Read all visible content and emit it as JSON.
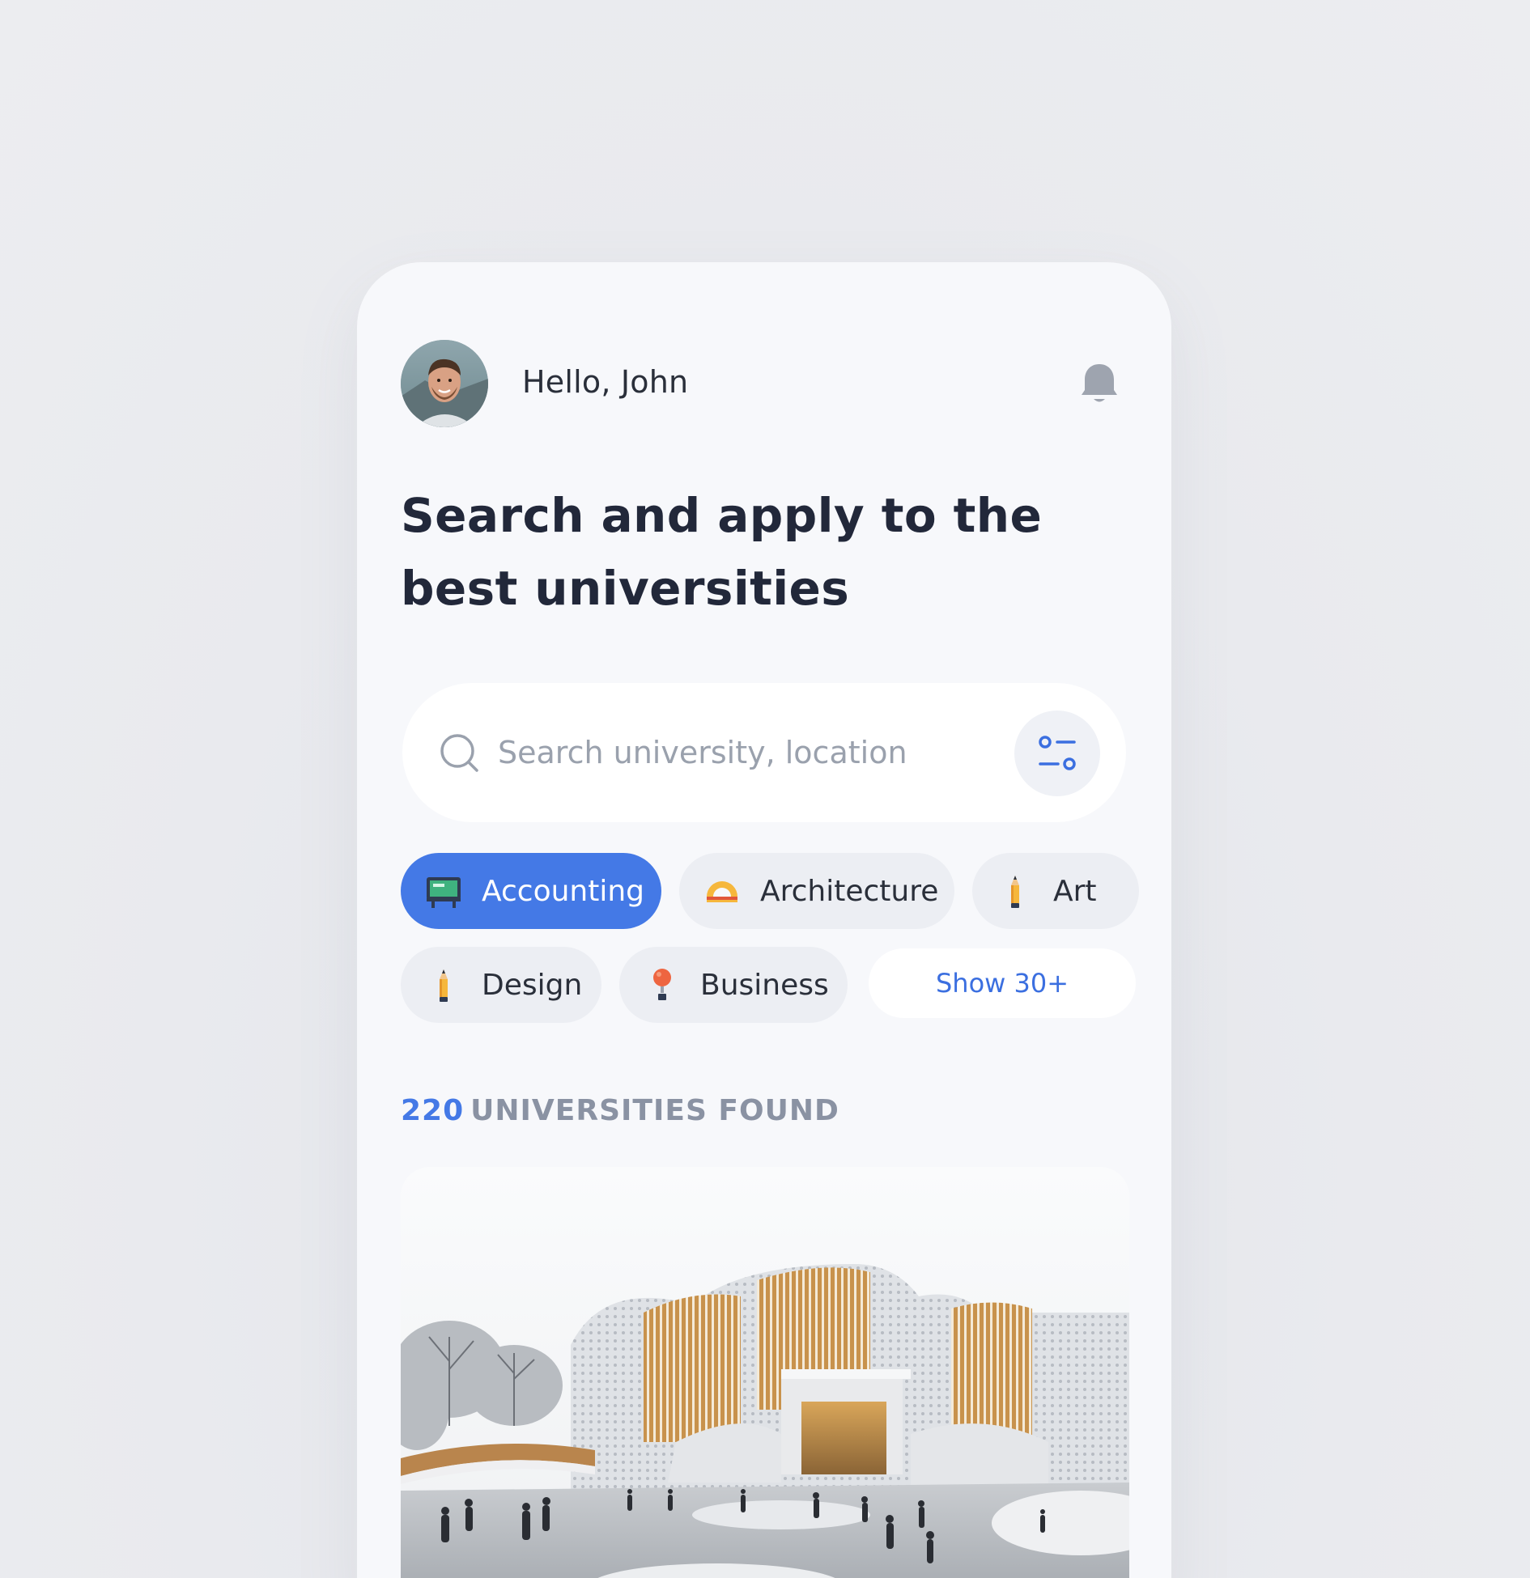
{
  "header": {
    "greeting": "Hello, John"
  },
  "headline": "Search and apply to the best universities",
  "search": {
    "placeholder": "Search university, location"
  },
  "categories": [
    {
      "label": "Accounting",
      "icon": "chalkboard-icon",
      "active": true
    },
    {
      "label": "Architecture",
      "icon": "protractor-icon",
      "active": false
    },
    {
      "label": "Art",
      "icon": "pencil-icon",
      "active": false
    },
    {
      "label": "Design",
      "icon": "pencil-icon",
      "active": false
    },
    {
      "label": "Business",
      "icon": "pin-icon",
      "active": false
    }
  ],
  "show_more_label": "Show 30+",
  "results": {
    "count": "220",
    "label": "UNIVERSITIES FOUND"
  },
  "colors": {
    "accent": "#4479e6",
    "background": "#f7f8fb",
    "text": "#22283a"
  }
}
